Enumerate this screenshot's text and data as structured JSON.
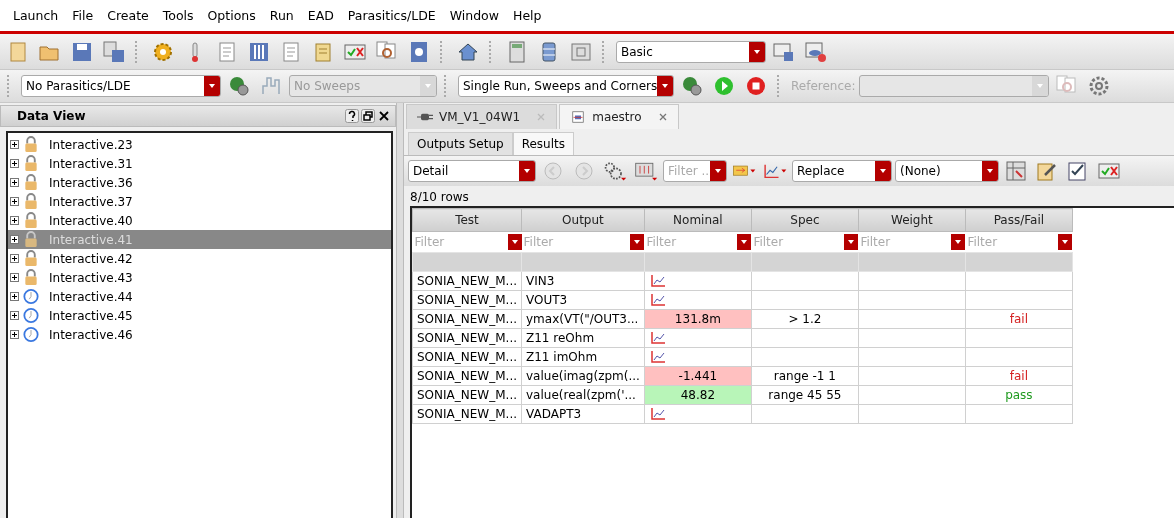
{
  "menu": [
    "Launch",
    "File",
    "Create",
    "Tools",
    "Options",
    "Run",
    "EAD",
    "Parasitics/LDE",
    "Window",
    "Help"
  ],
  "toolbar": {
    "view_combo": "Basic"
  },
  "run_toolbar": {
    "parasitics_combo": "No Parasitics/LDE",
    "sweeps_combo": {
      "value": "No Sweeps",
      "disabled": true
    },
    "mode_combo": "Single Run, Sweeps and Corners",
    "reference_label": {
      "text": "Reference:",
      "disabled": true
    }
  },
  "data_view": {
    "title": "Data View",
    "items": [
      {
        "label": "Interactive.23",
        "kind": "lock",
        "selected": false
      },
      {
        "label": "Interactive.31",
        "kind": "lock",
        "selected": false
      },
      {
        "label": "Interactive.36",
        "kind": "lock",
        "selected": false
      },
      {
        "label": "Interactive.37",
        "kind": "lock",
        "selected": false
      },
      {
        "label": "Interactive.40",
        "kind": "lock",
        "selected": false
      },
      {
        "label": "Interactive.41",
        "kind": "lock",
        "selected": true
      },
      {
        "label": "Interactive.42",
        "kind": "lock",
        "selected": false
      },
      {
        "label": "Interactive.43",
        "kind": "lock",
        "selected": false
      },
      {
        "label": "Interactive.44",
        "kind": "clock",
        "selected": false
      },
      {
        "label": "Interactive.45",
        "kind": "clock",
        "selected": false
      },
      {
        "label": "Interactive.46",
        "kind": "clock",
        "selected": false
      }
    ]
  },
  "tabs": [
    {
      "label": "VM_V1_04W1",
      "selected": false
    },
    {
      "label": "maestro",
      "selected": true
    }
  ],
  "sub_tabs": [
    {
      "label": "Outputs Setup",
      "selected": false
    },
    {
      "label": "Results",
      "selected": true
    }
  ],
  "results_toolbar": {
    "view_combo": "Detail",
    "filter_placeholder": "Filter ...",
    "plot_mode_combo": "Replace",
    "combo_4": "(None)"
  },
  "row_count": "8/10 rows",
  "table": {
    "columns": [
      {
        "title": "Test",
        "filter_placeholder": "Filter"
      },
      {
        "title": "Output",
        "filter_placeholder": "Filter"
      },
      {
        "title": "Nominal",
        "filter_placeholder": "Filter"
      },
      {
        "title": "Spec",
        "filter_placeholder": "Filter"
      },
      {
        "title": "Weight",
        "filter_placeholder": "Filter"
      },
      {
        "title": "Pass/Fail",
        "filter_placeholder": "Filter"
      }
    ],
    "rows": [
      {
        "test": "SONIA_NEW_M...",
        "output": "VIN3",
        "nominal": {
          "kind": "plot"
        }
      },
      {
        "test": "SONIA_NEW_M...",
        "output": "VOUT3",
        "nominal": {
          "kind": "plot"
        }
      },
      {
        "test": "SONIA_NEW_M...",
        "output": "ymax(VT(\"/OUT3...",
        "nominal": {
          "kind": "value",
          "text": "131.8m"
        },
        "spec": "> 1.2",
        "passed": false,
        "pass_fail": "fail"
      },
      {
        "test": "SONIA_NEW_M...",
        "output": "Z11 reOhm",
        "nominal": {
          "kind": "plot"
        }
      },
      {
        "test": "SONIA_NEW_M...",
        "output": "Z11 imOhm",
        "nominal": {
          "kind": "plot"
        }
      },
      {
        "test": "SONIA_NEW_M...",
        "output": "value(imag(zpm(...",
        "nominal": {
          "kind": "value",
          "text": "-1.441"
        },
        "spec": "range -1 1",
        "passed": false,
        "pass_fail": "fail"
      },
      {
        "test": "SONIA_NEW_M...",
        "output": "value(real(zpm('...",
        "nominal": {
          "kind": "value",
          "text": "48.82"
        },
        "spec": "range 45 55",
        "passed": true,
        "pass_fail": "pass"
      },
      {
        "test": "SONIA_NEW_M...",
        "output": "VADAPT3",
        "nominal": {
          "kind": "plot"
        }
      }
    ]
  }
}
